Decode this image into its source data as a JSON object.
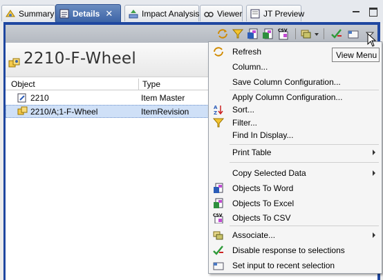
{
  "tabs": [
    {
      "label": "Summary",
      "icon": "summary-icon"
    },
    {
      "label": "Details",
      "icon": "details-icon",
      "active": true
    },
    {
      "label": "Impact Analysis",
      "icon": "impact-analysis-icon"
    },
    {
      "label": "Viewer",
      "icon": "viewer-icon"
    },
    {
      "label": "JT Preview",
      "icon": "jt-preview-icon"
    }
  ],
  "header": {
    "title": "2210-F-Wheel",
    "icon": "item-revision-icon"
  },
  "table": {
    "columns": [
      "Object",
      "Type"
    ],
    "rows": [
      {
        "object": "2210",
        "type": "Item Master",
        "icon": "item-master-icon"
      },
      {
        "object": "2210/A;1-F-Wheel",
        "type": "ItemRevision",
        "icon": "item-revision-icon",
        "selected": true
      }
    ]
  },
  "menu": {
    "items": [
      {
        "label": "Refresh",
        "icon": "refresh-icon"
      },
      {
        "label": "Column...",
        "icon": ""
      },
      {
        "label": "Save Column Configuration...",
        "icon": ""
      },
      {
        "label": "Apply Column Configuration...",
        "icon": ""
      },
      {
        "label": "Sort...",
        "icon": "sort-icon"
      },
      {
        "label": "Filter...",
        "icon": "filter-icon"
      },
      {
        "label": "Find In Display...",
        "icon": ""
      },
      {
        "label": "Print Table",
        "icon": "",
        "submenu": true
      },
      {
        "label": "Copy Selected Data",
        "icon": "",
        "submenu": true
      },
      {
        "label": "Objects To Word",
        "icon": "word-icon"
      },
      {
        "label": "Objects To Excel",
        "icon": "excel-icon"
      },
      {
        "label": "Objects To CSV",
        "icon": "csv-icon"
      },
      {
        "label": "Associate...",
        "icon": "associate-icon",
        "submenu": true
      },
      {
        "label": "Disable response to selections",
        "icon": "disable-response-icon"
      },
      {
        "label": "Set input to recent selection",
        "icon": "recent-selection-icon"
      }
    ]
  },
  "tooltip": {
    "text": "View Menu"
  },
  "toolbar": {
    "buttons": [
      "refresh-icon",
      "filter-icon",
      "word-icon",
      "excel-icon",
      "csv-icon",
      "associate-icon",
      "disable-response-icon",
      "recent-selection-icon",
      "view-menu-icon"
    ]
  },
  "colors": {
    "accent": "#1f47a0",
    "active_tab": "#3d64a6",
    "selection": "#cfe0f7"
  }
}
